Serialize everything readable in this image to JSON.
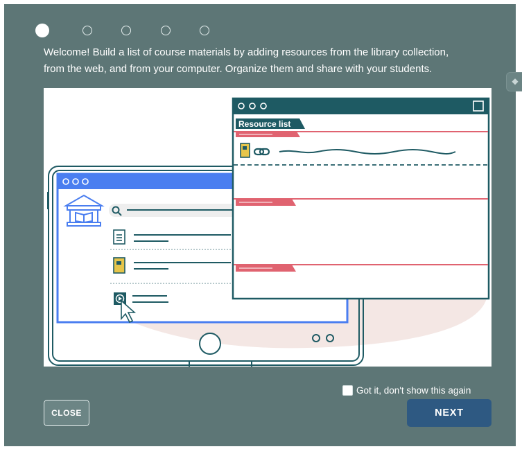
{
  "stepper": {
    "total_steps": 5,
    "current_step": 1
  },
  "intro": {
    "line1": "Welcome! Build a list of course materials by adding resources from the library collection,",
    "line2": "from the web, and from your computer. Organize them and share with your students."
  },
  "illustration": {
    "resource_list_title": "Resource list"
  },
  "footer": {
    "checkbox_label": "Got it, don't show this again",
    "checkbox_checked": false,
    "close_label": "CLOSE",
    "next_label": "NEXT"
  },
  "colors": {
    "modal_bg": "#5d7676",
    "next_button": "#2e5982",
    "illustration_teal": "#1e5a63",
    "illustration_blue": "#4a7ef0",
    "illustration_red": "#e06370",
    "illustration_yellow": "#e6c54a"
  },
  "icons": [
    "library-icon",
    "search-icon",
    "document-icon",
    "book-icon",
    "video-icon",
    "cursor-icon",
    "link-icon",
    "home-button-icon"
  ]
}
